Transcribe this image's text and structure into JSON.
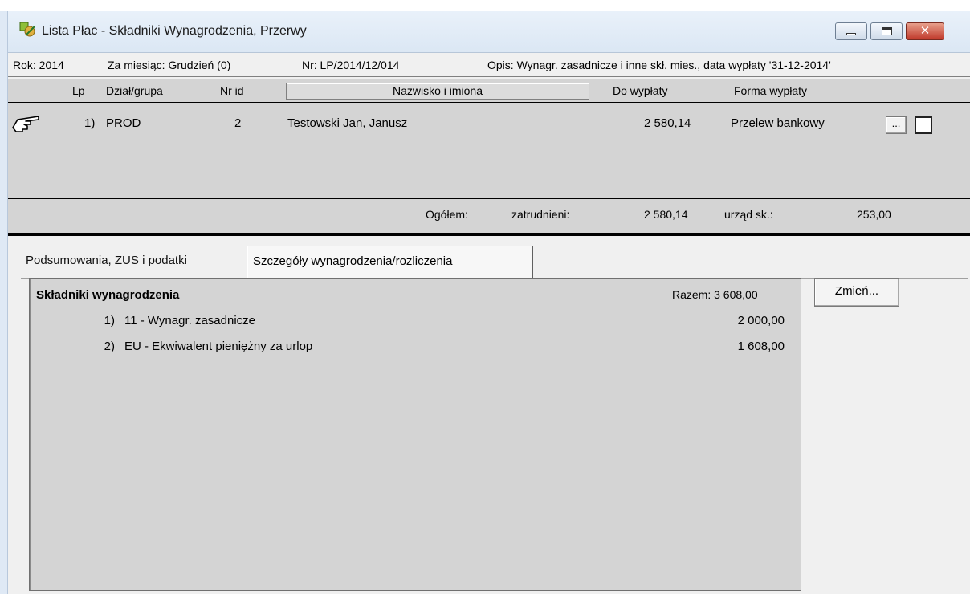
{
  "window": {
    "title": "Lista Płac - Składniki Wynagrodzenia, Przerwy",
    "icon": "payroll-app-icon",
    "controls": {
      "minimize": "minimize-icon",
      "maximize": "maximize-icon",
      "close": "✕"
    }
  },
  "info": {
    "rok": "Rok: 2014",
    "miesiac": "Za miesiąc: Grudzień (0)",
    "nr": "Nr: LP/2014/12/014",
    "opis": "Opis:  Wynagr. zasadnicze i inne skł. mies., data wypłaty '31-12-2014'"
  },
  "grid": {
    "headers": {
      "lp": "Lp",
      "dzial": "Dział/grupa",
      "nrid": "Nr id",
      "nazwisko": "Nazwisko i imiona",
      "do_wyplaty": "Do wypłaty",
      "forma": "Forma wypłaty"
    },
    "rows": [
      {
        "lp": "1)",
        "dzial": "PROD",
        "nrid": "2",
        "nazwisko": "Testowski Jan, Janusz",
        "do_wyplaty": "2 580,14",
        "forma": "Przelew bankowy",
        "button": "...",
        "checked": false
      }
    ],
    "summary": {
      "label": "Ogółem:",
      "zatrudnieni_label": "zatrudnieni:",
      "zatrudnieni_value": "2 580,14",
      "urzad_label": "urząd sk.:",
      "urzad_value": "253,00"
    }
  },
  "tabs": [
    {
      "label": "Podsumowania, ZUS i podatki",
      "active": false
    },
    {
      "label": "Szczegóły wynagrodzenia/rozliczenia",
      "active": true
    }
  ],
  "panel": {
    "heading": "Składniki wynagrodzenia",
    "total": "Razem: 3 608,00",
    "items": [
      {
        "idx": "1)",
        "name": "11 - Wynagr. zasadnicze",
        "value": "2 000,00"
      },
      {
        "idx": "2)",
        "name": "EU - Ekwiwalent pieniężny za urlop",
        "value": "1 608,00"
      }
    ]
  },
  "buttons": {
    "zmien": "Zmień..."
  }
}
